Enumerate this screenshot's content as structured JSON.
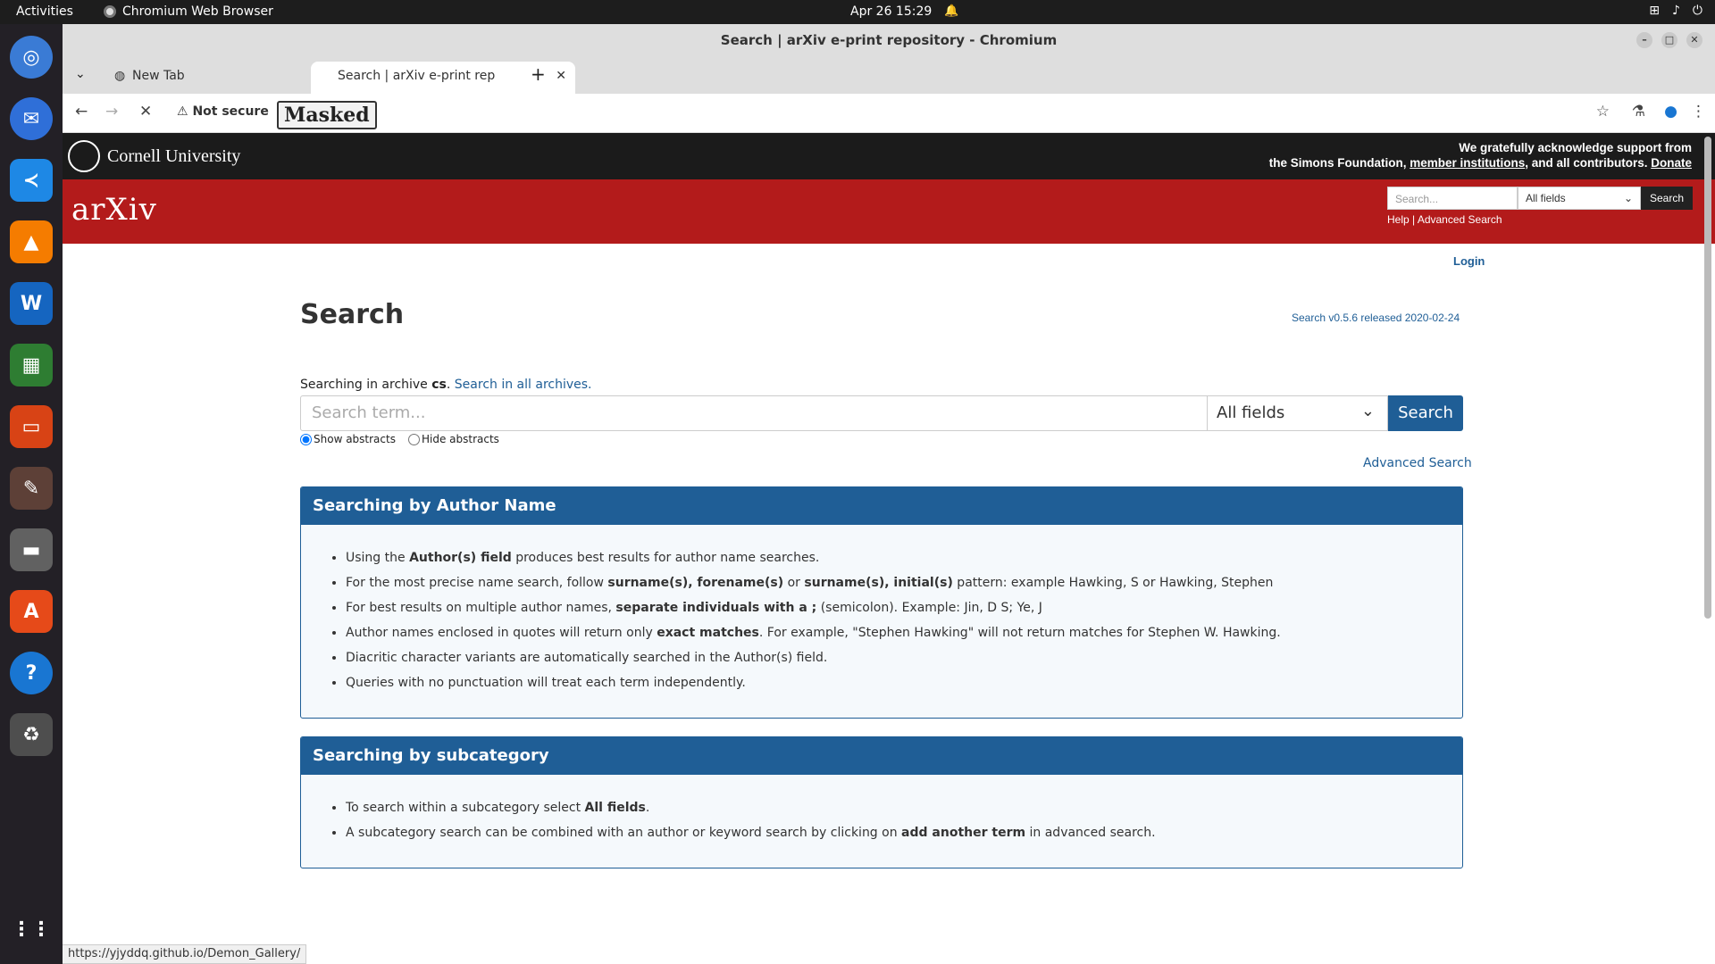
{
  "os": {
    "activities": "Activities",
    "app_name": "Chromium Web Browser",
    "clock": "Apr 26  15:29"
  },
  "dock": {
    "items": [
      "chromium-icon",
      "thunderbird-icon",
      "vscode-icon",
      "vlc-icon",
      "writer-icon",
      "calc-icon",
      "impress-icon",
      "gimp-icon",
      "files-icon",
      "app-center-icon",
      "help-icon",
      "trash-icon",
      "app-grid-icon"
    ]
  },
  "browser": {
    "window_title": "Search | arXiv e-print repository - Chromium",
    "tabs": [
      {
        "label": "New Tab"
      },
      {
        "label": "Search | arXiv e-print rep"
      }
    ],
    "not_secure": "Not secure",
    "masked": "Masked",
    "status_url": "https://yjyddq.github.io/Demon_Gallery/"
  },
  "header": {
    "cornell": "Cornell University",
    "ack_line1": "We gratefully acknowledge support from",
    "ack_line2_pre": "the Simons Foundation, ",
    "ack_link": "member institutions",
    "ack_line2_mid": ", and all contributors. ",
    "donate": "Donate",
    "arxiv": "arXiv",
    "search_placeholder": "Search...",
    "search_field": "All fields",
    "search_button": "Search",
    "help": "Help",
    "sep": " | ",
    "advanced": "Advanced Search",
    "login": "Login"
  },
  "main": {
    "title": "Search",
    "version": "Search v0.5.6 released 2020-02-24",
    "archive_pre": "Searching in archive ",
    "archive_name": "cs",
    "archive_post": ". ",
    "all_archives": "Search in all archives.",
    "term_placeholder": "Search term...",
    "field_value": "All fields",
    "search_button": "Search",
    "show_abstracts": "Show abstracts",
    "hide_abstracts": "Hide abstracts",
    "advanced_search": "Advanced Search"
  },
  "panels": [
    {
      "title": "Searching by Author Name",
      "items": [
        {
          "pre": "Using the ",
          "b1": "Author(s) field",
          "post": " produces best results for author name searches."
        },
        {
          "pre": "For the most precise name search, follow ",
          "b1": "surname(s), forename(s)",
          "mid": " or ",
          "b2": "surname(s), initial(s)",
          "post": " pattern: example Hawking, S or Hawking, Stephen"
        },
        {
          "pre": "For best results on multiple author names, ",
          "b1": "separate individuals with a ;",
          "post": " (semicolon). Example: Jin, D S; Ye, J"
        },
        {
          "pre": "Author names enclosed in quotes will return only ",
          "b1": "exact matches",
          "post": ". For example, \"Stephen Hawking\" will not return matches for Stephen W. Hawking."
        },
        {
          "pre": "Diacritic character variants are automatically searched in the Author(s) field.",
          "b1": "",
          "post": ""
        },
        {
          "pre": "Queries with no punctuation will treat each term independently.",
          "b1": "",
          "post": ""
        }
      ]
    },
    {
      "title": "Searching by subcategory",
      "items": [
        {
          "pre": "To search within a subcategory select ",
          "b1": "All fields",
          "post": "."
        },
        {
          "pre": "A subcategory search can be combined with an author or keyword search by clicking on ",
          "b1": "add another term",
          "post": " in advanced search."
        }
      ]
    }
  ]
}
